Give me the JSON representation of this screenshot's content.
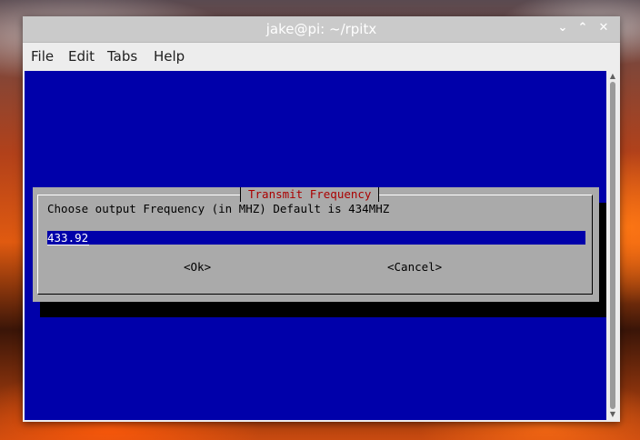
{
  "window": {
    "title": "jake@pi: ~/rpitx",
    "controls": {
      "minimize": "⌄",
      "maximize": "⌃",
      "close": "✕"
    }
  },
  "menubar": {
    "items": [
      "File",
      "Edit",
      "Tabs",
      "Help"
    ]
  },
  "dialog": {
    "title": "Transmit Frequency",
    "prompt": "Choose output Frequency (in MHZ) Default is 434MHZ",
    "input_value": "433.92",
    "ok_label": "<Ok>",
    "cancel_label": "<Cancel>"
  },
  "colors": {
    "terminal_bg": "#0000aa",
    "dialog_bg": "#aaaaaa",
    "dialog_title": "#aa0000"
  }
}
